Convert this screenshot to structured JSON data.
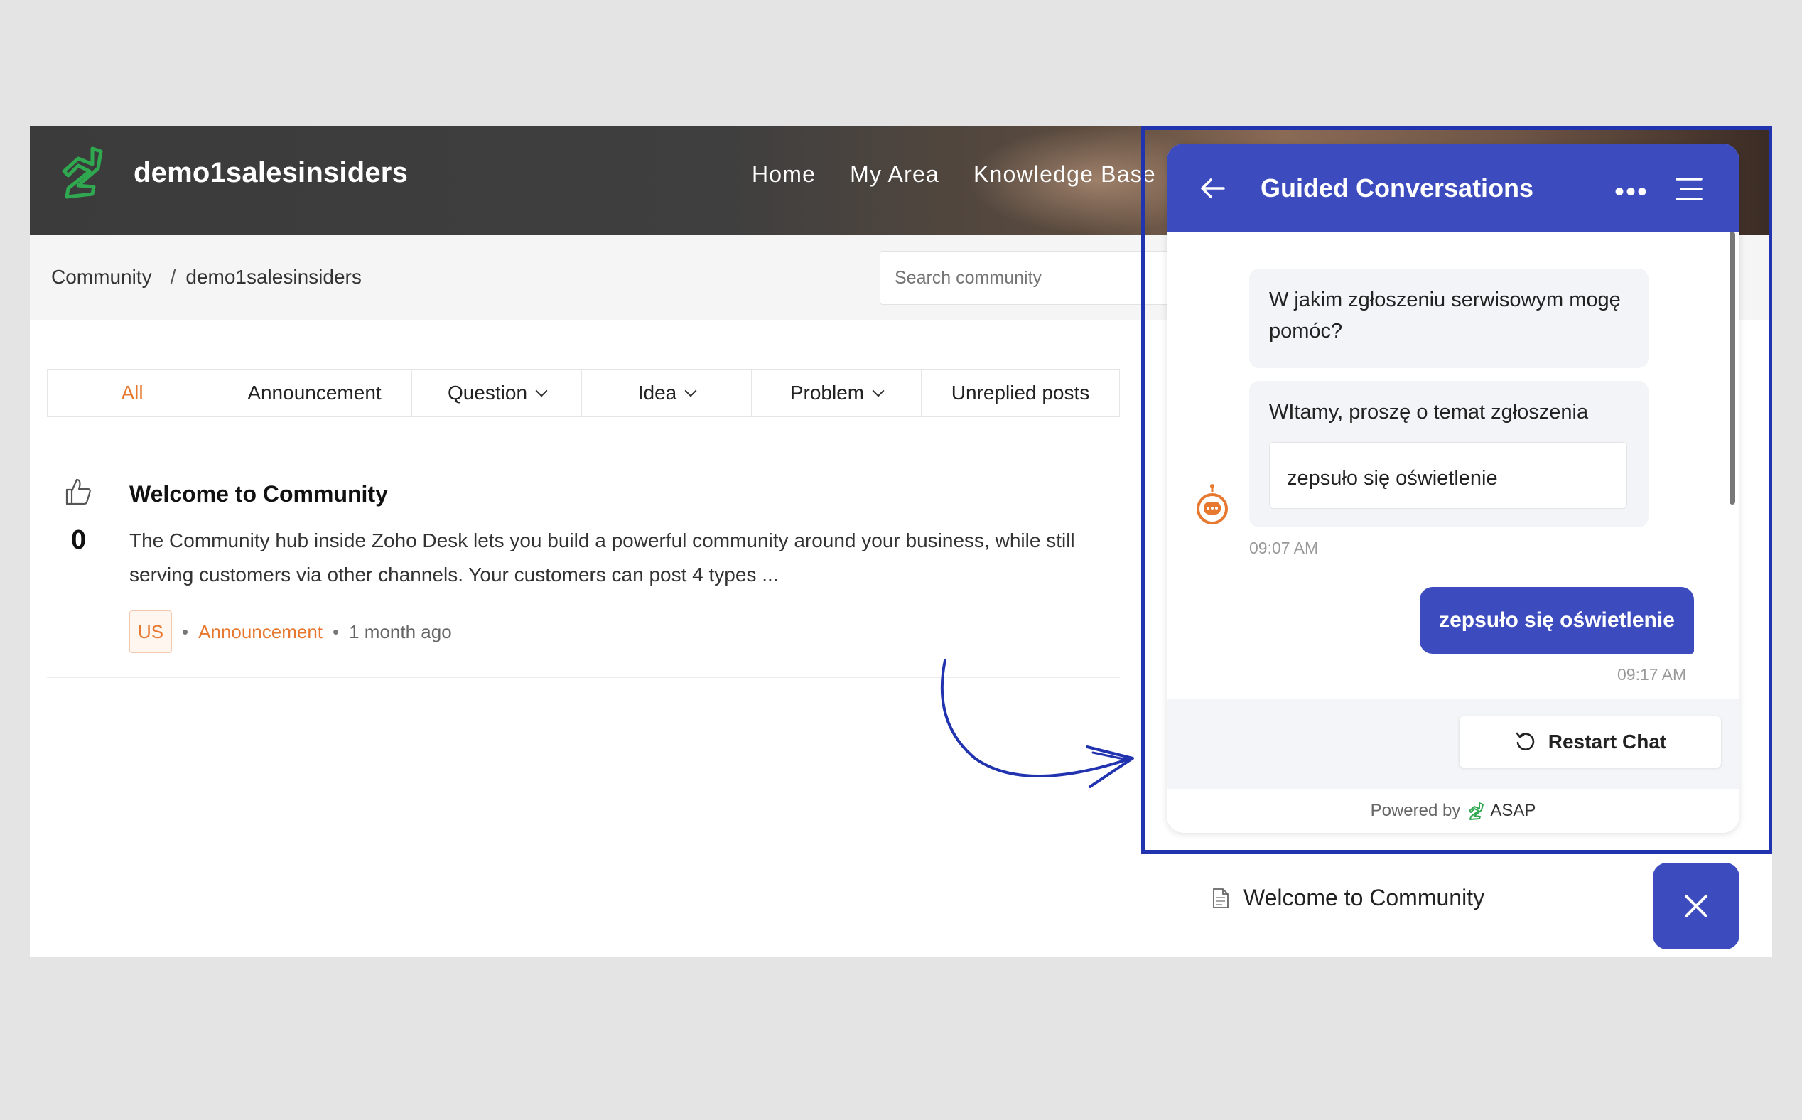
{
  "site": {
    "brand": "demo1salesinsiders",
    "nav": [
      "Home",
      "My Area",
      "Knowledge Base"
    ]
  },
  "breadcrumb": {
    "root": "Community",
    "current": "demo1salesinsiders"
  },
  "search": {
    "placeholder": "Search community"
  },
  "tabs": [
    {
      "label": "All",
      "active": true,
      "dropdown": false
    },
    {
      "label": "Announcement",
      "active": false,
      "dropdown": false
    },
    {
      "label": "Question",
      "active": false,
      "dropdown": true
    },
    {
      "label": "Idea",
      "active": false,
      "dropdown": true
    },
    {
      "label": "Problem",
      "active": false,
      "dropdown": true
    },
    {
      "label": "Unreplied posts",
      "active": false,
      "dropdown": false
    }
  ],
  "post": {
    "title": "Welcome to Community",
    "votes": "0",
    "body": "The Community hub inside Zoho Desk lets you build a powerful community around your business, while still serving customers via other channels. Your customers can post 4 types ...",
    "avatar": "US",
    "category": "Announcement",
    "age": "1 month ago"
  },
  "chat": {
    "title": "Guided Conversations",
    "more_icon": "more-dots-icon",
    "messages": {
      "bot_question": "W jakim zgłoszeniu serwisowym mogę pomóc?",
      "bot_prompt": "WItamy, proszę o temat zgłoszenia",
      "choice": "zepsuło się oświetlenie",
      "bot_time": "09:07 AM",
      "user_reply": "zepsuło się oświetlenie",
      "user_time": "09:17 AM"
    },
    "restart_label": "Restart Chat",
    "powered_by": "Powered by",
    "powered_brand": "ASAP"
  },
  "doc_link": "Welcome to Community",
  "colors": {
    "accent": "#3c4cbf",
    "highlight": "#2233b0",
    "orange": "#e6782f",
    "logo_green": "#2fa84f"
  }
}
